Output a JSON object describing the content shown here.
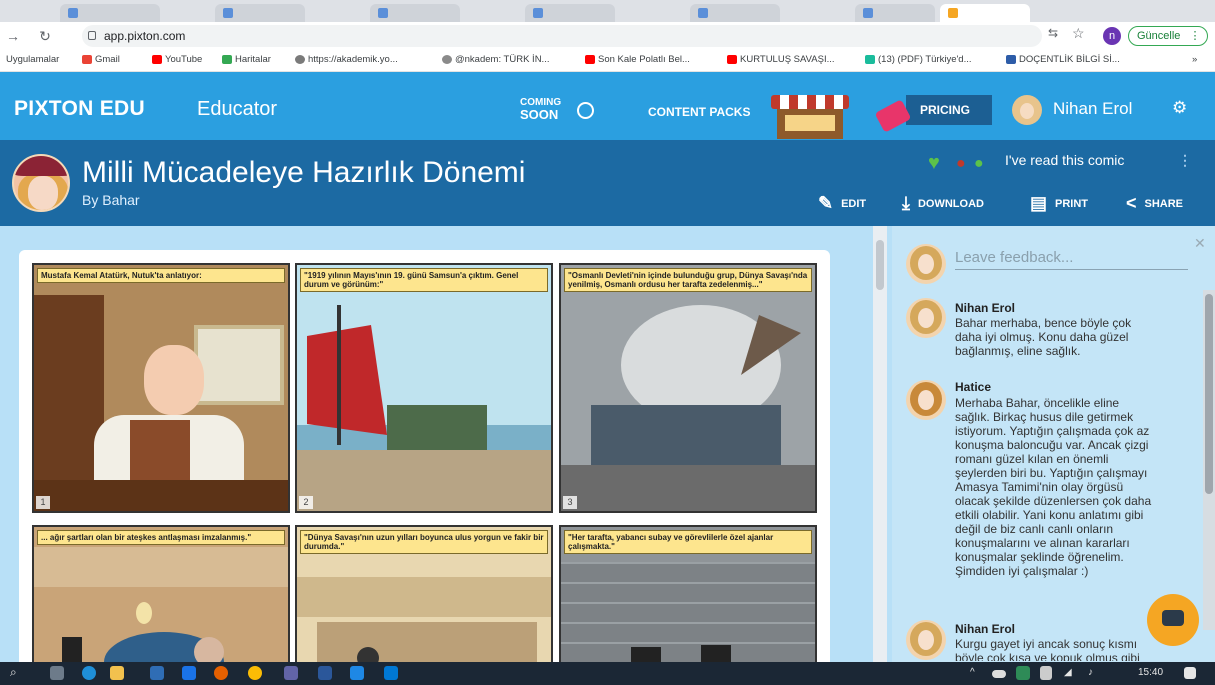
{
  "browser": {
    "url": "app.pixton.com",
    "update_label": "Güncelle",
    "profile_initial": "n",
    "bookmarks": [
      "Uygulamalar",
      "Gmail",
      "YouTube",
      "Haritalar",
      "https://akademik.yo...",
      "@nkadem: TÜRK İN...",
      "Son Kale Polatlı Bel...",
      "KURTULUŞ SAVAŞI...",
      "(13) (PDF) Türkiye'd...",
      "DOÇENTLİK BİLGİ Sİ..."
    ],
    "more_bookmarks": "»"
  },
  "header": {
    "logo": "PIXTON EDU",
    "logo_sub": "Educator",
    "coming_soon": [
      "COMING",
      "SOON"
    ],
    "content_packs": "CONTENT PACKS",
    "pricing": "PRICING",
    "user_name": "Nihan Erol"
  },
  "comic": {
    "title": "Milli Mücadeleye Hazırlık Dönemi",
    "byline": "By Bahar",
    "read_label": "I've read this comic",
    "actions": {
      "edit": "EDIT",
      "download": "DOWNLOAD",
      "print": "PRINT",
      "share": "SHARE"
    },
    "panels": [
      {
        "caption": "Mustafa Kemal Atatürk, Nutuk'ta anlatıyor:",
        "number": "1"
      },
      {
        "caption": "\"1919 yılının Mayıs'ının 19. günü Samsun'a çıktım. Genel durum ve görünüm:\"",
        "number": "2"
      },
      {
        "caption": "\"Osmanlı Devleti'nin içinde bulunduğu grup, Dünya Savaşı'nda yenilmiş, Osmanlı ordusu her tarafta zedelenmiş...\"",
        "number": "3"
      },
      {
        "caption": "... ağır şartları olan bir ateşkes antlaşması imzalanmış.\"",
        "number": ""
      },
      {
        "caption": "\"Dünya Savaşı'nın uzun yılları boyunca ulus yorgun ve fakir bir durumda.\"",
        "number": ""
      },
      {
        "caption": "\"Her tarafta, yabancı subay ve görevlilerle özel ajanlar çalışmakta.\"",
        "number": ""
      }
    ]
  },
  "feedback": {
    "placeholder": "Leave feedback...",
    "comments": [
      {
        "author": "Nihan Erol",
        "text": "Bahar merhaba, bence böyle çok daha iyi olmuş. Konu daha güzel bağlanmış, eline sağlık."
      },
      {
        "author": "Hatice",
        "text": "Merhaba Bahar, öncelikle eline sağlık. Birkaç husus dile getirmek istiyorum. Yaptığın çalışmada çok az konuşma baloncuğu var. Ancak çizgi romanı güzel kılan en önemli şeylerden biri bu. Yaptığın çalışmayı Amasya Tamimi'nin olay örgüsü olacak şekilde düzenlersen çok daha etkili olabilir. Yani konu anlatımı gibi değil de biz canlı canlı onların konuşmalarını ve alınan kararları konuşmalar şeklinde öğrenelim. Şimdiden iyi çalışmalar :)"
      },
      {
        "author": "Nihan Erol",
        "text": "Kurgu gayet iyi ancak sonuç kısmı böyle çok kısa ve kopuk olmuş gibi"
      }
    ]
  },
  "taskbar": {
    "time": "15:40"
  },
  "colors": {
    "header_blue": "#2b9fe0",
    "comic_header": "#1c6aa3",
    "panel_bg": "#b8e0f7",
    "caption_yellow": "#fde58e",
    "chat_fab": "#f5a623"
  }
}
